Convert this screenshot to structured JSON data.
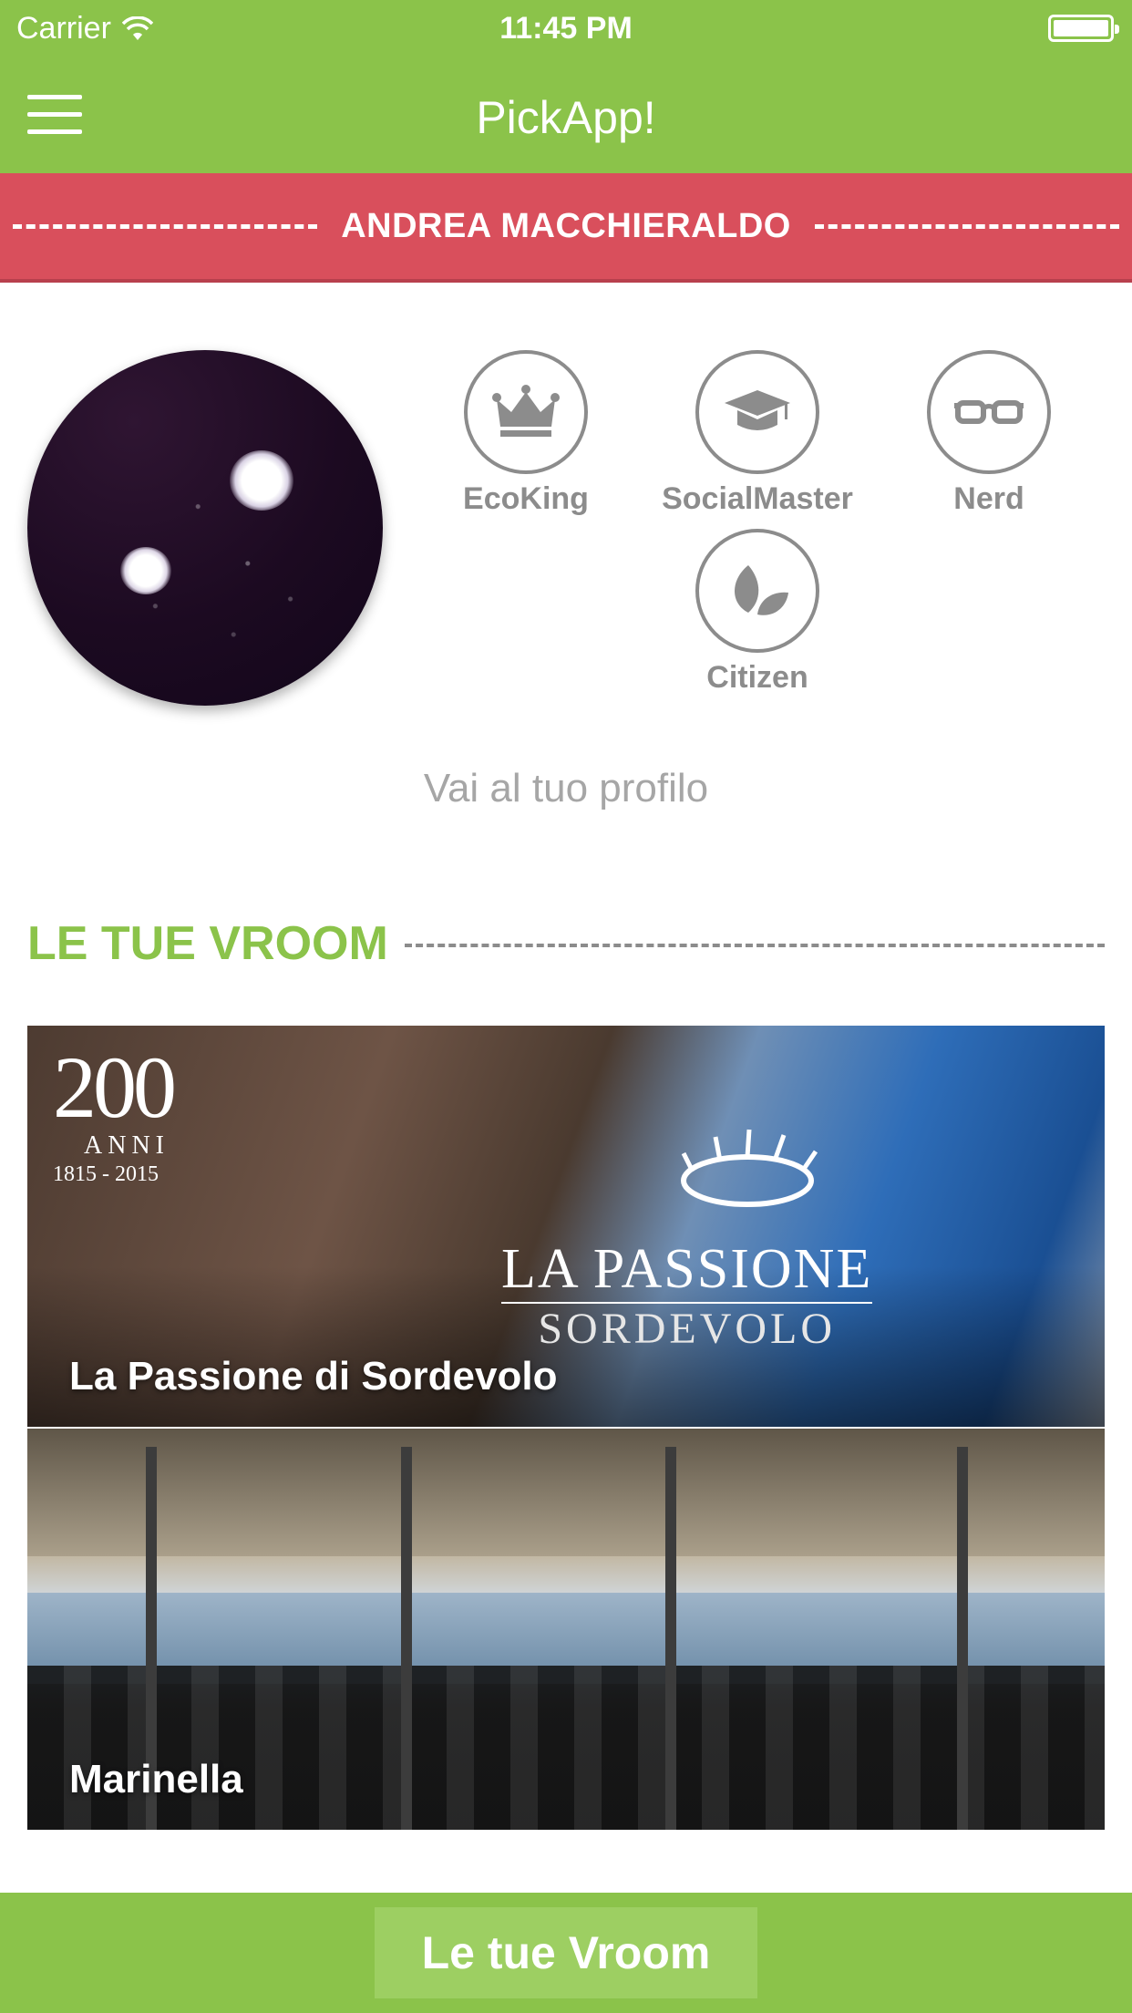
{
  "status_bar": {
    "carrier": "Carrier",
    "time": "11:45 PM"
  },
  "header": {
    "title": "PickApp!",
    "menu_icon": "hamburger-menu-icon"
  },
  "user": {
    "name": "ANDREA MACCHIERALDO"
  },
  "badges": [
    {
      "label": "EcoKing",
      "icon": "crown-icon"
    },
    {
      "label": "SocialMaster",
      "icon": "graduation-cap-icon"
    },
    {
      "label": "Nerd",
      "icon": "glasses-icon"
    },
    {
      "label": "Citizen",
      "icon": "leaf-icon"
    }
  ],
  "profile_link": "Vai al tuo profilo",
  "section": {
    "title": "LE TUE VROOM"
  },
  "cards": [
    {
      "title": "La Passione di Sordevolo",
      "logo_big": "200",
      "logo_anni": "ANNI",
      "logo_years": "1815 - 2015",
      "logo_main": "LA PASSIONE",
      "logo_sub": "SORDEVOLO"
    },
    {
      "title": "Marinella"
    }
  ],
  "bottom_button": "Le tue Vroom",
  "colors": {
    "primary_green": "#8bc34a",
    "banner_red": "#d94f5c",
    "badge_gray": "#8c8c8c"
  }
}
